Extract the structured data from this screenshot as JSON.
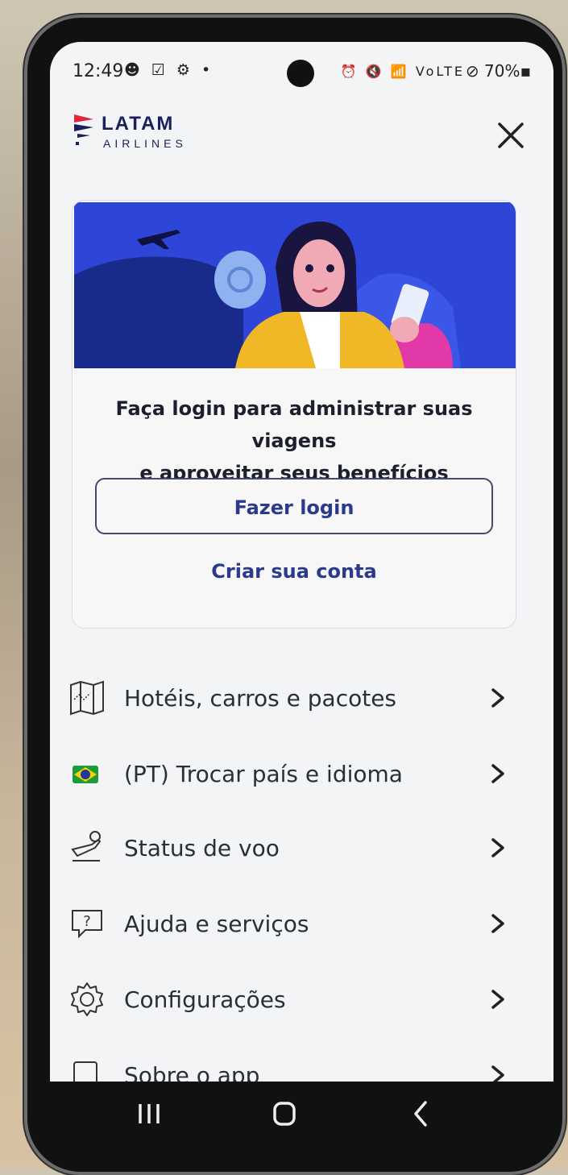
{
  "status_bar": {
    "time": "12:49",
    "left_icons": "☻ ☑ ⚙ •",
    "right_icons": "⏰ 🔇 📶 VoLTE ",
    "battery": "⊘ 70%▪"
  },
  "header": {
    "brand_name": "LATAM",
    "brand_sub": "AIRLINES",
    "close_icon": "close-icon"
  },
  "login_card": {
    "title_line1": "Faça login para administrar suas viagens",
    "title_line2": "e aproveitar seus benefícios",
    "login_button": "Fazer login",
    "create_account": "Criar sua conta"
  },
  "menu": {
    "items": [
      {
        "label": "Hotéis, carros e pacotes",
        "icon": "map-icon"
      },
      {
        "label": "(PT) Trocar país e idioma",
        "icon": "brazil-flag-icon"
      },
      {
        "label": "Status de voo",
        "icon": "flight-status-icon"
      },
      {
        "label": "Ajuda e serviços",
        "icon": "help-icon"
      },
      {
        "label": "Configurações",
        "icon": "gear-icon"
      },
      {
        "label": "Sobre o app",
        "icon": "info-icon"
      }
    ]
  },
  "colors": {
    "brand_navy": "#1b1f5c",
    "link_blue": "#2b3a8c",
    "banner_blue": "#2e46d8"
  }
}
